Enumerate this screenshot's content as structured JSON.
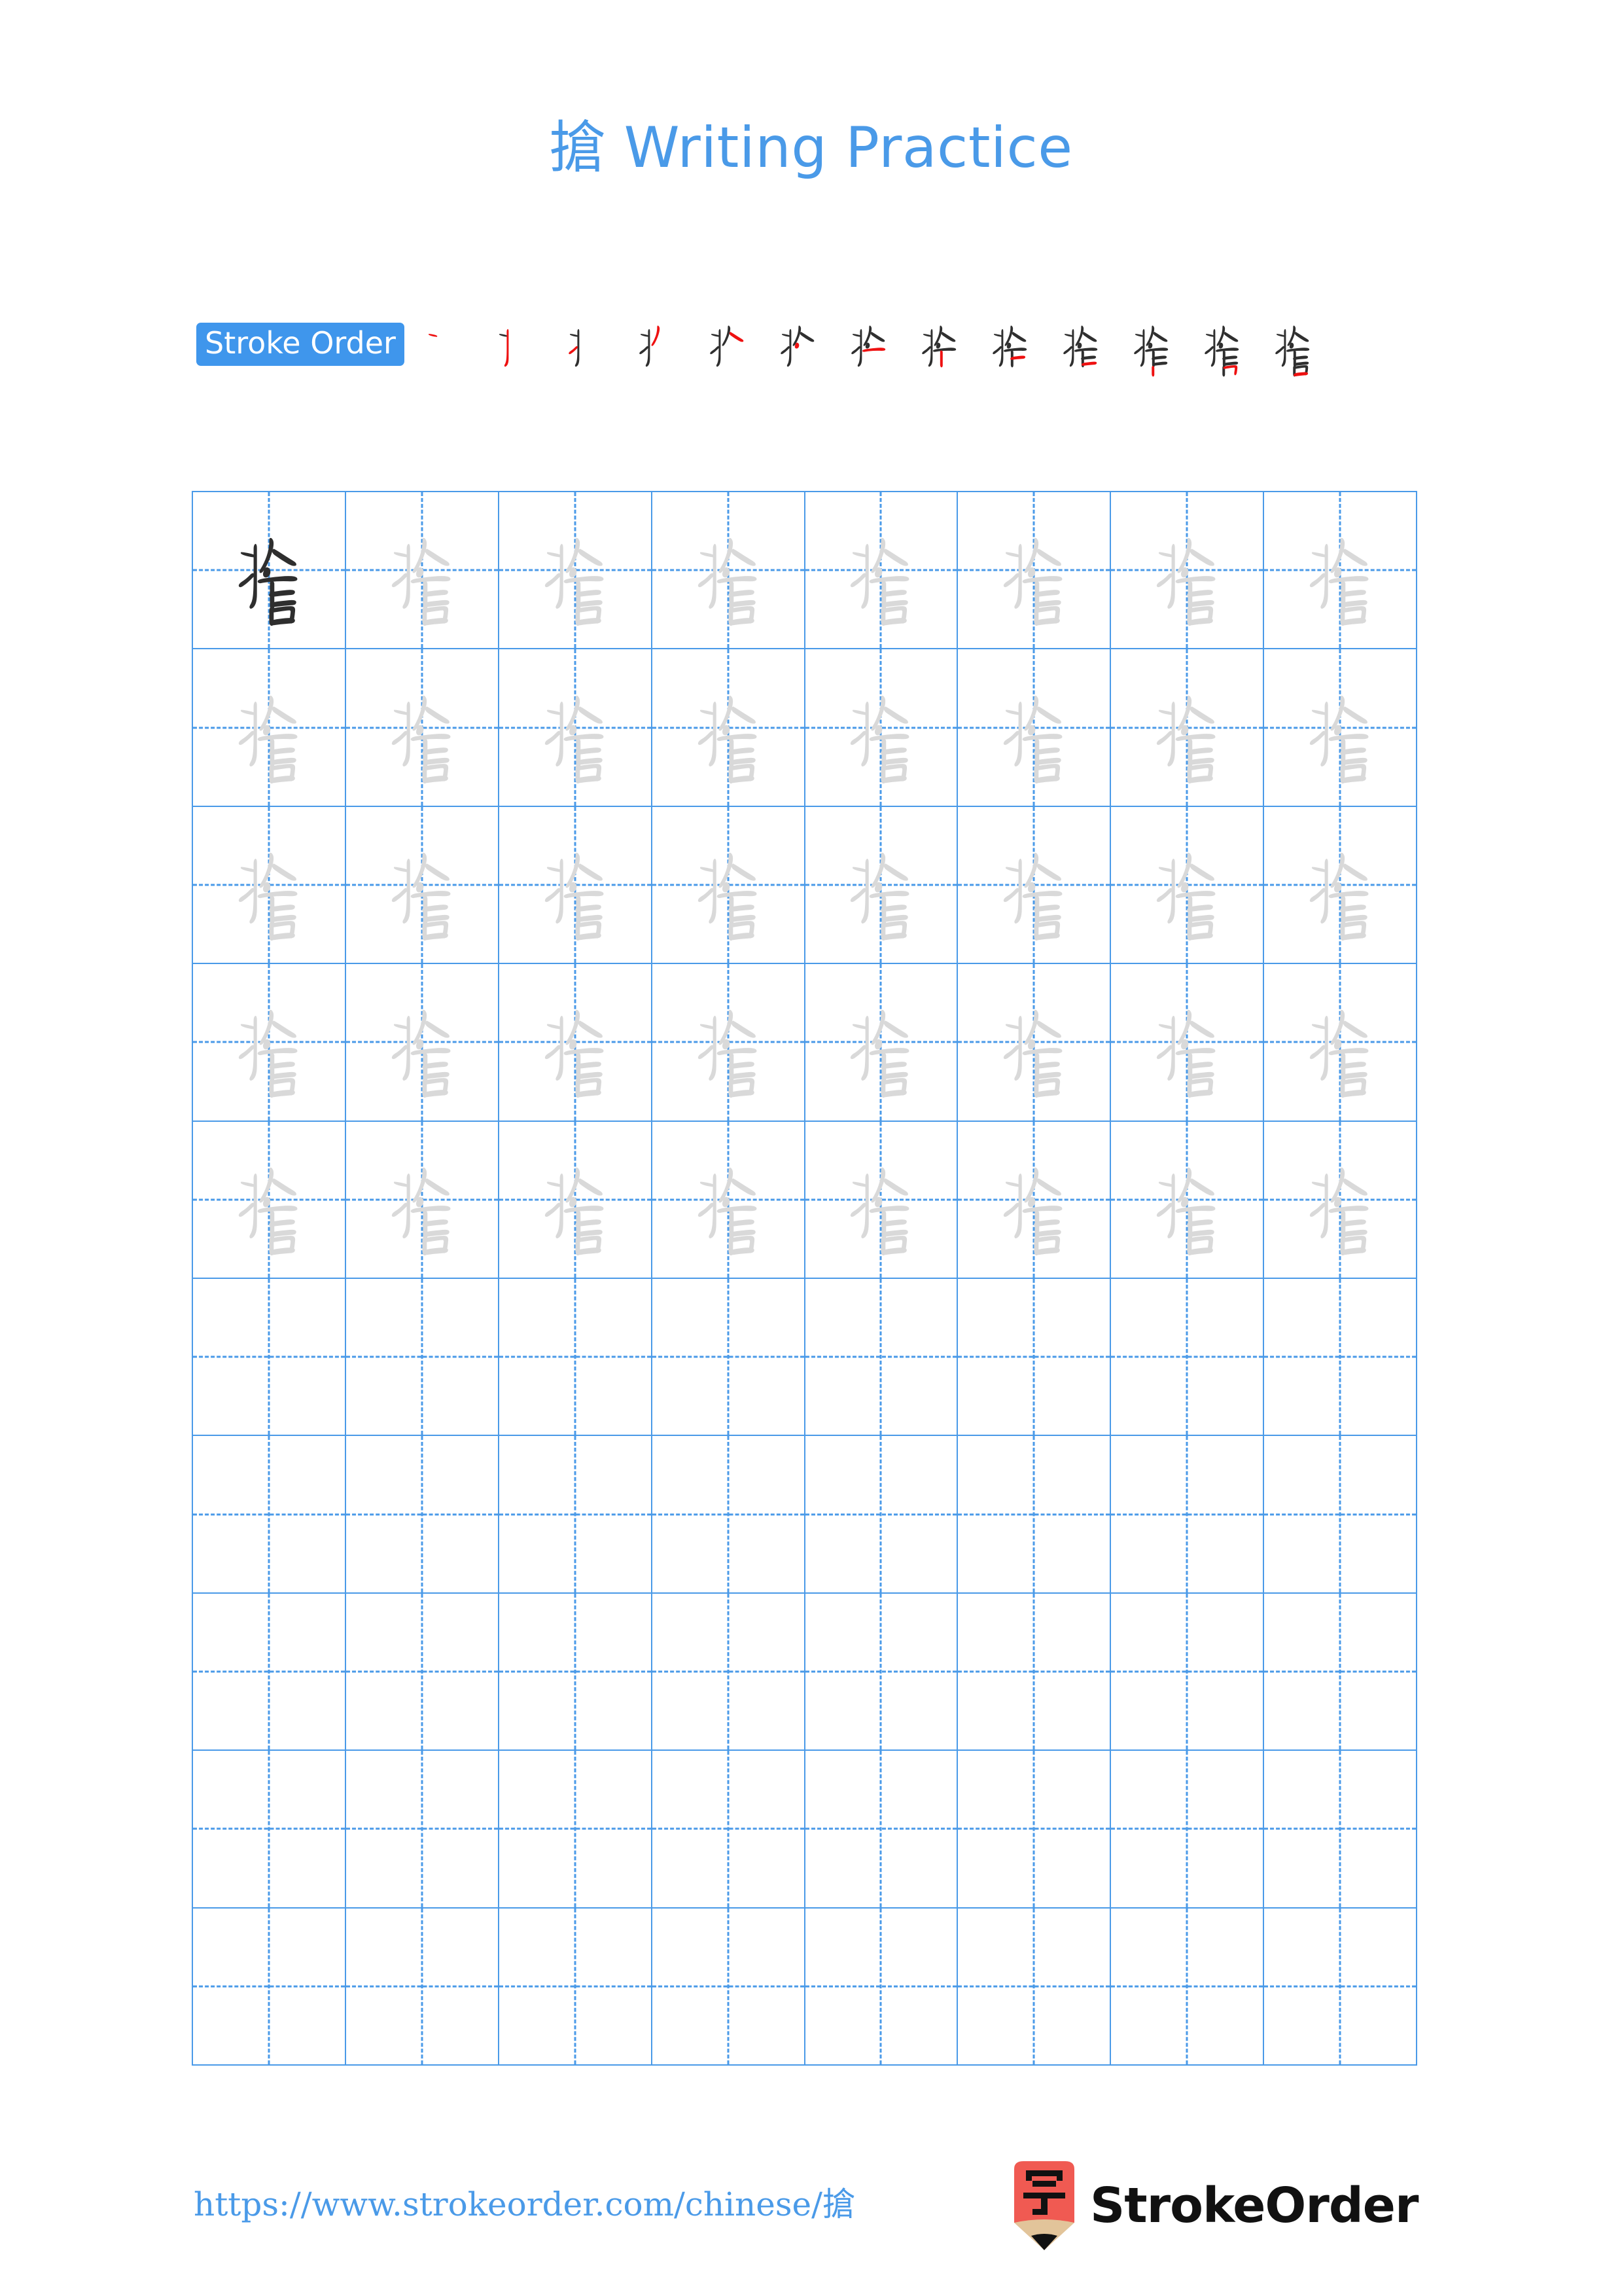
{
  "page": {
    "character": "搶",
    "title_suffix": " Writing Practice",
    "title_full": "搶 Writing Practice",
    "background": "#ffffff"
  },
  "colors": {
    "accent_blue": "#4a9ae8",
    "badge_blue": "#3f96ec",
    "stroke_new_red": "#ee1111",
    "stroke_done_black": "#2f2f2f",
    "practice_gray": "#d9d9d9",
    "grid_line": "#4a9ae8",
    "logo_red": "#f05a52",
    "logo_wood": "#e2c49a"
  },
  "stroke_order": {
    "badge_label": "Stroke Order",
    "total_strokes": 13,
    "steps": [
      {
        "index": 1,
        "char": "搶",
        "new_stroke": 1
      },
      {
        "index": 2,
        "char": "搶",
        "new_stroke": 2
      },
      {
        "index": 3,
        "char": "搶",
        "new_stroke": 3
      },
      {
        "index": 4,
        "char": "搶",
        "new_stroke": 4
      },
      {
        "index": 5,
        "char": "搶",
        "new_stroke": 5
      },
      {
        "index": 6,
        "char": "搶",
        "new_stroke": 6
      },
      {
        "index": 7,
        "char": "搶",
        "new_stroke": 7
      },
      {
        "index": 8,
        "char": "搶",
        "new_stroke": 8
      },
      {
        "index": 9,
        "char": "搶",
        "new_stroke": 9
      },
      {
        "index": 10,
        "char": "搶",
        "new_stroke": 10
      },
      {
        "index": 11,
        "char": "搶",
        "new_stroke": 11
      },
      {
        "index": 12,
        "char": "搶",
        "new_stroke": 12
      },
      {
        "index": 13,
        "char": "搶",
        "new_stroke": 13
      }
    ]
  },
  "practice_grid": {
    "columns": 8,
    "rows": 10,
    "rows_data": [
      {
        "row": 1,
        "cells": [
          "dark",
          "light",
          "light",
          "light",
          "light",
          "light",
          "light",
          "light"
        ]
      },
      {
        "row": 2,
        "cells": [
          "light",
          "light",
          "light",
          "light",
          "light",
          "light",
          "light",
          "light"
        ]
      },
      {
        "row": 3,
        "cells": [
          "light",
          "light",
          "light",
          "light",
          "light",
          "light",
          "light",
          "light"
        ]
      },
      {
        "row": 4,
        "cells": [
          "light",
          "light",
          "light",
          "light",
          "light",
          "light",
          "light",
          "light"
        ]
      },
      {
        "row": 5,
        "cells": [
          "light",
          "light",
          "light",
          "light",
          "light",
          "light",
          "light",
          "light"
        ]
      },
      {
        "row": 6,
        "cells": [
          "empty",
          "empty",
          "empty",
          "empty",
          "empty",
          "empty",
          "empty",
          "empty"
        ]
      },
      {
        "row": 7,
        "cells": [
          "empty",
          "empty",
          "empty",
          "empty",
          "empty",
          "empty",
          "empty",
          "empty"
        ]
      },
      {
        "row": 8,
        "cells": [
          "empty",
          "empty",
          "empty",
          "empty",
          "empty",
          "empty",
          "empty",
          "empty"
        ]
      },
      {
        "row": 9,
        "cells": [
          "empty",
          "empty",
          "empty",
          "empty",
          "empty",
          "empty",
          "empty",
          "empty"
        ]
      },
      {
        "row": 10,
        "cells": [
          "empty",
          "empty",
          "empty",
          "empty",
          "empty",
          "empty",
          "empty",
          "empty"
        ]
      }
    ]
  },
  "footer": {
    "url": "https://www.strokeorder.com/chinese/搶",
    "brand_name": "StrokeOrder",
    "logo_char": "字"
  }
}
